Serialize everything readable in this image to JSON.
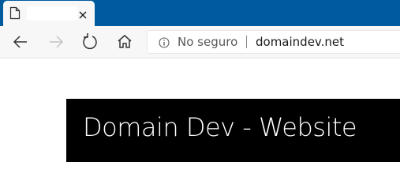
{
  "browser": {
    "tab": {
      "title": "",
      "favicon": "page-icon",
      "close_icon": "close-icon"
    },
    "toolbar": {
      "back_icon": "back-arrow-icon",
      "forward_icon": "forward-arrow-icon",
      "refresh_icon": "refresh-icon",
      "home_icon": "home-icon",
      "info_icon": "info-icon",
      "security_label": "No seguro",
      "url": "domaindev.net"
    },
    "colors": {
      "tabstrip": "#005a9e",
      "toolbar": "#f7f7f7",
      "banner": "#000000"
    }
  },
  "page": {
    "banner_title": "Domain Dev - Website"
  }
}
